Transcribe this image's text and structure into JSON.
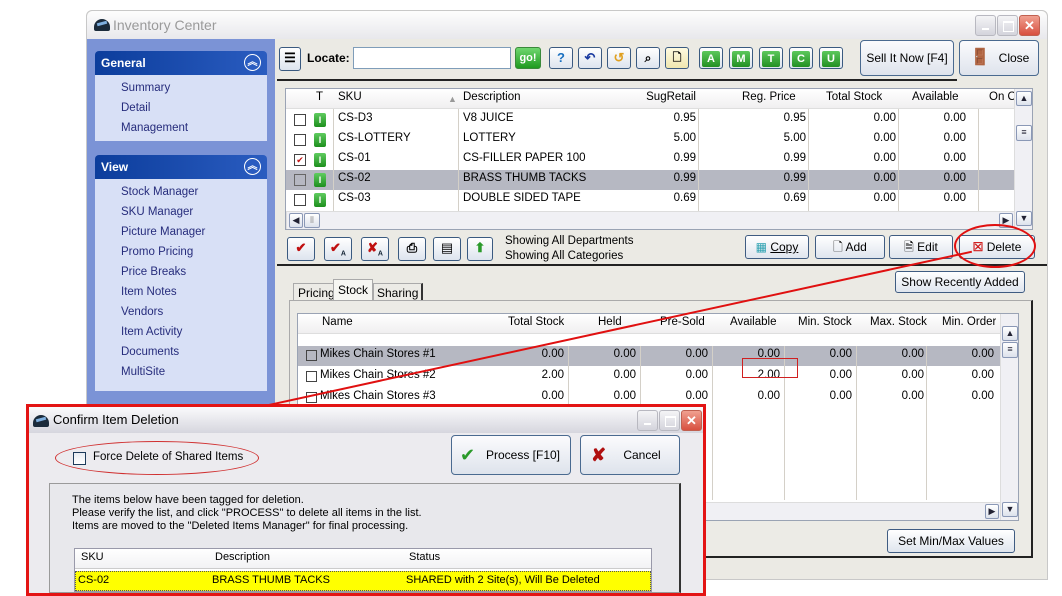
{
  "window": {
    "title": "Inventory Center"
  },
  "sidebar": {
    "groups": [
      {
        "label": "General",
        "items": [
          "Summary",
          "Detail",
          "Management"
        ]
      },
      {
        "label": "View",
        "items": [
          "Stock Manager",
          "SKU Manager",
          "Picture Manager",
          "Promo Pricing",
          "Price Breaks",
          "Item Notes",
          "Vendors",
          "Item Activity",
          "Documents",
          "MultiSite"
        ]
      }
    ]
  },
  "toolbar": {
    "locate_label": "Locate:",
    "locate_value": "",
    "go_label": "go!",
    "help_label": "?",
    "letter_buttons": [
      "A",
      "M",
      "T",
      "C",
      "U"
    ],
    "sell_label": "Sell It Now [F4]",
    "close_label": "Close"
  },
  "items_grid": {
    "columns": [
      "T",
      "SKU",
      "Description",
      "SugRetail",
      "Reg. Price",
      "Total Stock",
      "Available",
      "On O"
    ],
    "rows": [
      {
        "checked": false,
        "type": "I",
        "sku": "CS-D3",
        "description": "V8 JUICE",
        "sugretail": "0.95",
        "reg_price": "0.95",
        "total_stock": "0.00",
        "available": "0.00",
        "selected": false
      },
      {
        "checked": false,
        "type": "I",
        "sku": "CS-LOTTERY",
        "description": "LOTTERY",
        "sugretail": "5.00",
        "reg_price": "5.00",
        "total_stock": "0.00",
        "available": "0.00",
        "selected": false
      },
      {
        "checked": true,
        "type": "I",
        "sku": "CS-01",
        "description": "CS-FILLER PAPER 100",
        "sugretail": "0.99",
        "reg_price": "0.99",
        "total_stock": "0.00",
        "available": "0.00",
        "selected": false
      },
      {
        "checked": false,
        "type": "I",
        "sku": "CS-02",
        "description": "BRASS THUMB TACKS",
        "sugretail": "0.99",
        "reg_price": "0.99",
        "total_stock": "0.00",
        "available": "0.00",
        "selected": true
      },
      {
        "checked": false,
        "type": "I",
        "sku": "CS-03",
        "description": "DOUBLE SIDED TAPE",
        "sugretail": "0.69",
        "reg_price": "0.69",
        "total_stock": "0.00",
        "available": "0.00",
        "selected": false
      }
    ]
  },
  "filter_status": {
    "departments": "Showing All Departments",
    "categories": "Showing All Categories"
  },
  "actions": {
    "copy": "Copy",
    "add": "Add",
    "edit": "Edit",
    "delete": "Delete"
  },
  "detail_tabs": {
    "tabs": [
      "Pricing",
      "Stock",
      "Sharing"
    ],
    "active": "Stock"
  },
  "show_recent_label": "Show Recently Added",
  "stock_grid": {
    "columns": [
      "Name",
      "Total Stock",
      "Held",
      "Pre-Sold",
      "Available",
      "Min. Stock",
      "Max. Stock",
      "Min. Order"
    ],
    "rows": [
      {
        "name": "Mikes Chain Stores #1",
        "total": "0.00",
        "held": "0.00",
        "presold": "0.00",
        "available": "0.00",
        "min": "0.00",
        "max": "0.00",
        "minorder": "0.00",
        "selected": true
      },
      {
        "name": "Mikes Chain Stores #2",
        "total": "2.00",
        "held": "0.00",
        "presold": "0.00",
        "available": "2.00",
        "min": "0.00",
        "max": "0.00",
        "minorder": "0.00",
        "selected": false
      },
      {
        "name": "Mikes Chain Stores #3",
        "total": "0.00",
        "held": "0.00",
        "presold": "0.00",
        "available": "0.00",
        "min": "0.00",
        "max": "0.00",
        "minorder": "0.00",
        "selected": false
      }
    ]
  },
  "set_minmax_label": "Set Min/Max Values",
  "dialog": {
    "title": "Confirm Item Deletion",
    "force_delete_label": "Force Delete of Shared Items",
    "force_delete_checked": false,
    "process_label": "Process [F10]",
    "cancel_label": "Cancel",
    "message": [
      "The items below have been tagged for deletion.",
      "Please verify the list, and click \"PROCESS\" to delete all items in the list.",
      "Items are moved to the \"Deleted Items Manager\" for final processing."
    ],
    "columns": [
      "SKU",
      "Description",
      "Status"
    ],
    "rows": [
      {
        "sku": "CS-02",
        "description": "BRASS THUMB TACKS",
        "status": "SHARED with 2 Site(s), Will Be Deleted"
      }
    ]
  },
  "colors": {
    "annotation_red": "#e01010",
    "highlight_yellow": "#ffff00",
    "sidebar_header": "#0c3d9c"
  }
}
